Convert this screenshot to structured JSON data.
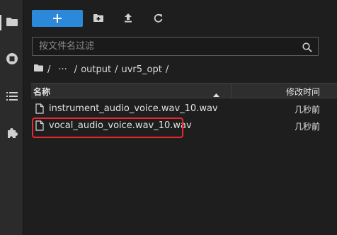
{
  "toolbar": {
    "new_label": "+",
    "new_icon": "plus-icon",
    "new_folder_icon": "new-folder-icon",
    "upload_icon": "upload-icon",
    "refresh_icon": "refresh-icon",
    "accent_color": "#2c88d9"
  },
  "search": {
    "placeholder": "按文件名过滤",
    "value": "",
    "icon": "search-icon"
  },
  "breadcrumb": {
    "root_icon": "folder-icon",
    "sep1": "/",
    "ellipsis": "···",
    "sep2": "/",
    "seg1": "output",
    "sep3": "/",
    "seg2": "uvr5_opt",
    "sep4": "/"
  },
  "table": {
    "col_name": "名称",
    "col_modified": "修改时间",
    "sort_direction": "ascending",
    "rows": [
      {
        "name": "instrument_audio_voice.wav_10.wav",
        "modified": "几秒前",
        "icon": "file-icon"
      },
      {
        "name": "vocal_audio_voice.wav_10.wav",
        "modified": "几秒前",
        "icon": "file-icon"
      }
    ]
  },
  "sidebar": {
    "items": [
      {
        "icon": "folder-icon",
        "active": true
      },
      {
        "icon": "stop-circle-icon",
        "active": false
      },
      {
        "icon": "list-icon",
        "active": false
      },
      {
        "icon": "puzzle-icon",
        "active": false
      }
    ]
  },
  "highlight_color": "#e8282e"
}
